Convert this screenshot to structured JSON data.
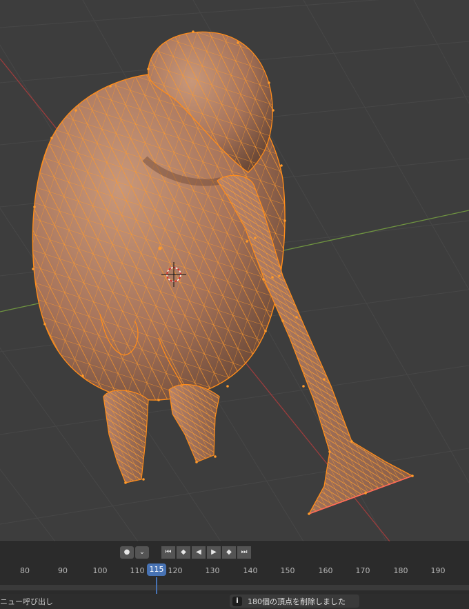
{
  "timeline": {
    "current_frame": "115",
    "ticks": [
      "80",
      "90",
      "100",
      "110",
      "120",
      "130",
      "140",
      "150",
      "160",
      "170",
      "180",
      "190"
    ]
  },
  "status": {
    "left_text": "ニュー呼び出し",
    "report_icon": "info-icon",
    "report_text": "180個の頂点を削除しました"
  },
  "colors": {
    "viewport_bg": "#3d3d3d",
    "selection": "#ff8c1a",
    "current_frame": "#4772b3",
    "x_axis": "#9c3d3d",
    "y_axis": "#6f9440"
  }
}
